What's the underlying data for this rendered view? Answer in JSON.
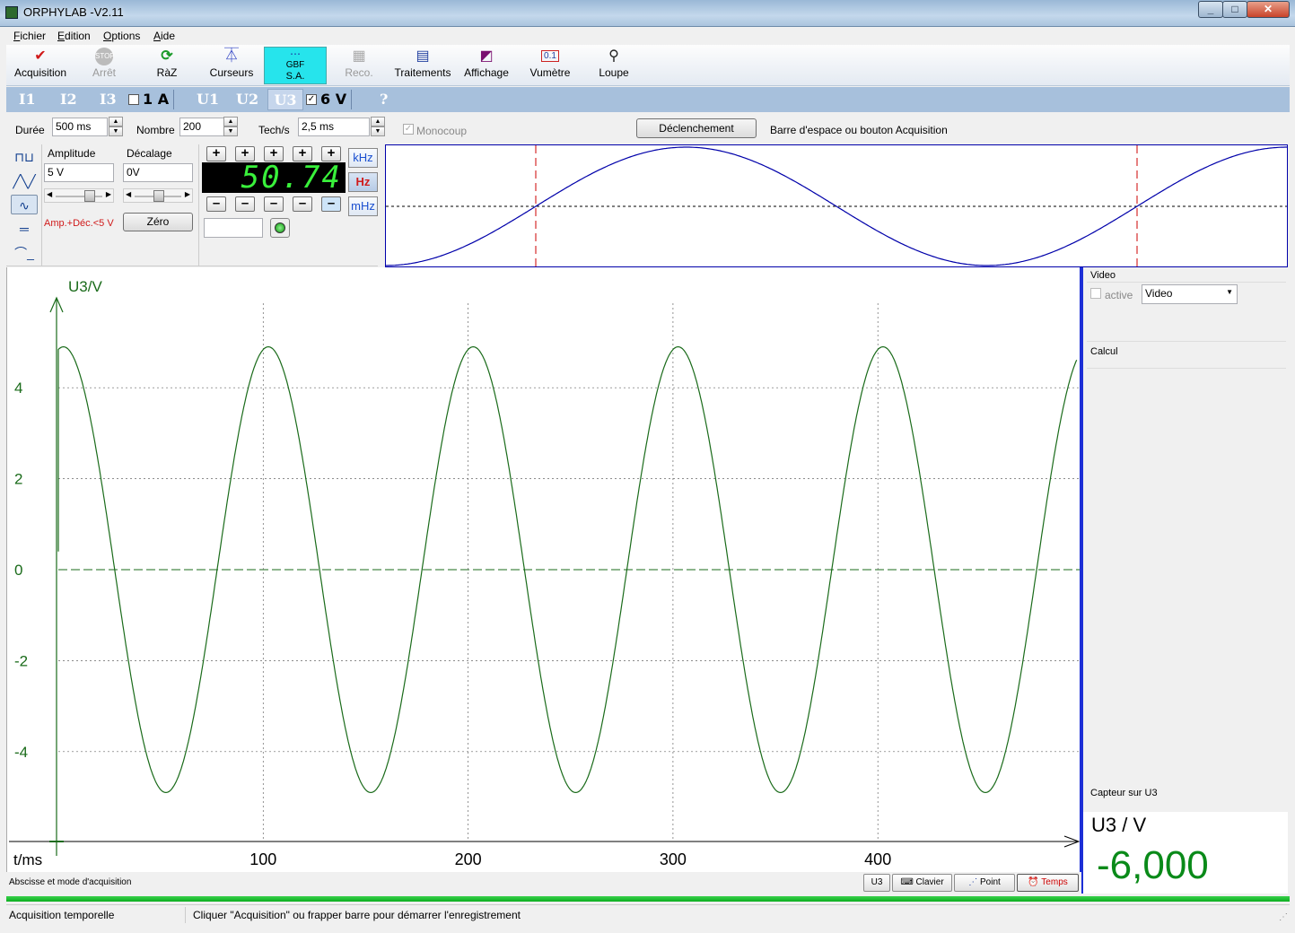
{
  "window": {
    "title": "ORPHYLAB -V2.11"
  },
  "menu": [
    "Fichier",
    "Edition",
    "Options",
    "Aide"
  ],
  "toolbar": [
    {
      "label": "Acquisition",
      "icon": "✔",
      "enabled": true
    },
    {
      "label": "Arrêt",
      "icon": "STOP",
      "enabled": false
    },
    {
      "label": "RàZ",
      "icon": "⟳",
      "enabled": true
    },
    {
      "label": "Curseurs",
      "icon": "⏄",
      "enabled": true
    },
    {
      "label": "S.A.",
      "sublabel": "GBF",
      "icon": "⋯",
      "enabled": true,
      "active": true
    },
    {
      "label": "Reco.",
      "icon": "▦",
      "enabled": false
    },
    {
      "label": "Traitements",
      "icon": "▤",
      "enabled": true
    },
    {
      "label": "Affichage",
      "icon": "◩",
      "enabled": true
    },
    {
      "label": "Vumètre",
      "icon": "0.1",
      "enabled": true
    },
    {
      "label": "Loupe",
      "icon": "⚲",
      "enabled": true
    }
  ],
  "channels": {
    "currents": [
      "I1",
      "I2",
      "I3"
    ],
    "current_range": "1 A",
    "voltages": [
      "U1",
      "U2",
      "U3"
    ],
    "voltage_range": "6 V",
    "help": "?"
  },
  "settings": {
    "duree_label": "Durée",
    "duree": "500 ms",
    "nombre_label": "Nombre",
    "nombre": "200",
    "tech_label": "Tech/s",
    "tech": "2,5 ms",
    "monocoup": "Monocoup",
    "trigger_button": "Déclenchement",
    "trigger_hint": "Barre d'espace ou bouton Acquisition"
  },
  "generator": {
    "amplitude_label": "Amplitude",
    "amplitude": "5 V",
    "decalage_label": "Décalage",
    "decalage": "0V",
    "warning": "Amp.+Déc.<5 V",
    "zero_button": "Zéro",
    "frequency_display": "50.74",
    "units": [
      "kHz",
      "Hz",
      "mHz"
    ],
    "selected_unit": "Hz",
    "plus": "+",
    "minus": "–"
  },
  "graph": {
    "ylabel": "U3/V",
    "xlabel": "t/ms",
    "yticks": [
      "4",
      "2",
      "0",
      "-2",
      "-4"
    ],
    "xticks": [
      "100",
      "200",
      "300",
      "400"
    ],
    "footer_text": "Abscisse et mode d'acquisition",
    "footer_buttons": [
      "U3",
      "Clavier",
      "Point",
      "Temps"
    ]
  },
  "chart_data": {
    "type": "line",
    "xlabel": "t/ms",
    "ylabel": "U3/V",
    "xlim": [
      0,
      500
    ],
    "ylim": [
      -6,
      6
    ],
    "series": [
      {
        "amplitude": 4.9,
        "frequency_hz": 10,
        "start_ms": 0,
        "end_ms": 500,
        "color": "#1a6b1a"
      }
    ],
    "grid": true
  },
  "right_panel": {
    "video_title": "Video",
    "video_active": "active",
    "video_select": "Video",
    "calcul_title": "Calcul",
    "capteur_title": "Capteur sur U3",
    "reading_label": "U3 / V",
    "reading_value": "-6,000"
  },
  "status": {
    "left": "Acquisition temporelle",
    "right": "Cliquer \"Acquisition\" ou frapper barre pour démarrer l'enregistrement"
  },
  "colors": {
    "trace": "#1a6b1a",
    "axis": "#1a6b1a",
    "lcd": "#39f13b",
    "divider": "#1c2fd6"
  }
}
